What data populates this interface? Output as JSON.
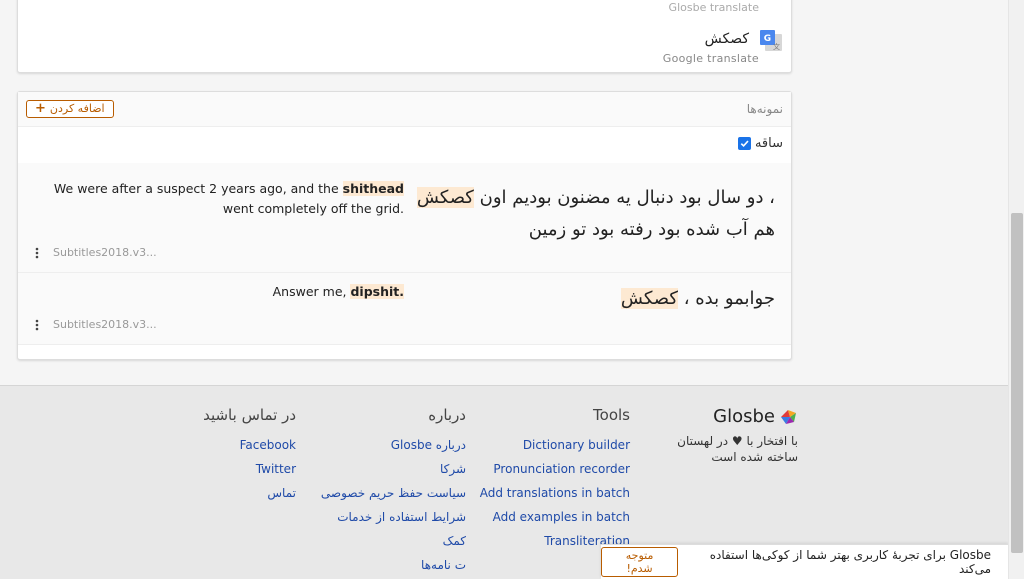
{
  "translation_card": {
    "faded_source": "Glosbe translate",
    "word": "کصکش",
    "source": "Google translate"
  },
  "examples": {
    "title": "نمونه‌ها",
    "add_label": "اضافه کردن",
    "filter_label": "ساقه",
    "rows": [
      {
        "fa_before": "، دو سال بود دنبال یه مضنون بودیم اون",
        "fa_highlight": "کصکش",
        "fa_after": "هم آب شده بود رفته بود تو زمین",
        "en_before": "We were after a suspect 2 years ago, and the",
        "en_highlight": "shithead",
        "en_after": "went completely off the grid.",
        "source": "Subtitles2018.v3..."
      },
      {
        "fa_before": "جوابمو بده ،",
        "fa_highlight": "کصکش",
        "fa_after": "",
        "en_before": "Answer me,",
        "en_highlight": "dipshit.",
        "en_after": "",
        "source": "Subtitles2018.v3..."
      }
    ]
  },
  "footer": {
    "brand": "Glosbe",
    "made_prefix": "با افتخار با",
    "heart": "♥",
    "made_suffix": "در لهستان ساخته شده است",
    "tools": {
      "title": "Tools",
      "links": [
        "Dictionary builder",
        "Pronunciation recorder",
        "Add translations in batch",
        "Add examples in batch",
        "Transliteration"
      ]
    },
    "about": {
      "title": "درباره",
      "links": [
        "درباره Glosbe",
        "شرکا",
        "سیاست حفظ حریم خصوصی",
        "شرایط استفاده از خدمات",
        "کمک"
      ],
      "partial_link": "ت نامه‌ها"
    },
    "contact": {
      "title": "در تماس باشید",
      "links": [
        "Facebook",
        "Twitter",
        "تماس"
      ]
    }
  },
  "cookie": {
    "text": "Glosbe برای تجربهٔ کاربری بهتر شما از کوکی‌ها استفاده می‌کند",
    "button": "متوجه شدم!"
  },
  "colors": {
    "accent": "#b85c00",
    "highlight": "#fde9d2",
    "link": "#1f4aa8",
    "checkbox": "#1a73e8"
  }
}
